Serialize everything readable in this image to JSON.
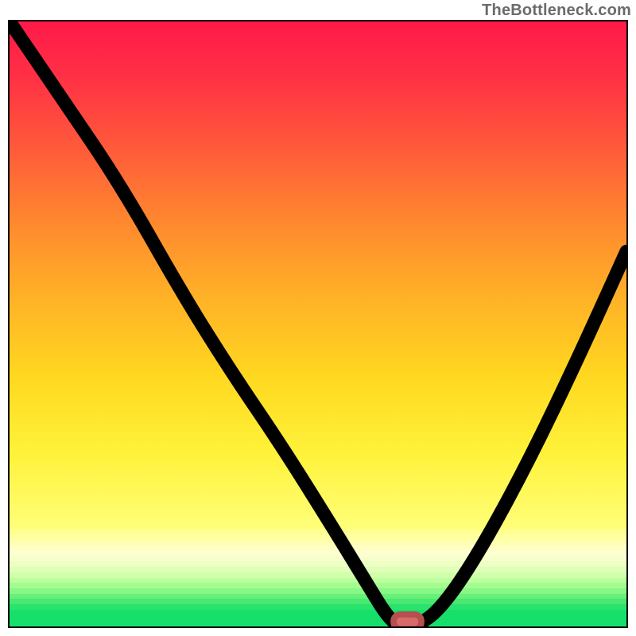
{
  "watermark": "TheBottleneck.com",
  "chart_data": {
    "type": "line",
    "title": "",
    "xlabel": "",
    "ylabel": "",
    "xlim": [
      0,
      100
    ],
    "ylim": [
      0,
      100
    ],
    "grid": false,
    "legend": false,
    "series": [
      {
        "name": "bottleneck-curve",
        "x": [
          0,
          8,
          18,
          28,
          36,
          44,
          52,
          58,
          61,
          63,
          66,
          70,
          76,
          84,
          92,
          100
        ],
        "y": [
          100,
          88,
          73,
          55,
          42,
          30,
          17,
          7,
          2,
          0,
          0,
          3,
          12,
          27,
          44,
          62
        ]
      }
    ],
    "marker": {
      "name": "optimal-point",
      "x": 64.5,
      "y": 0.8,
      "width": 4.5,
      "height": 2.4,
      "color": "#d96a6a"
    },
    "background_gradient": {
      "stops": [
        {
          "pos": 0,
          "color": "#ff1a49"
        },
        {
          "pos": 25,
          "color": "#ff5a3a"
        },
        {
          "pos": 55,
          "color": "#ffb326"
        },
        {
          "pos": 80,
          "color": "#fff23a"
        },
        {
          "pos": 92,
          "color": "#ffffb0"
        },
        {
          "pos": 97,
          "color": "#c7ff9e"
        },
        {
          "pos": 100,
          "color": "#16e06a"
        }
      ]
    },
    "step_bands": [
      "#ffff93",
      "#ffffa3",
      "#ffffb3",
      "#ffffc3",
      "#feffd0",
      "#f6ffca",
      "#edffc2",
      "#e0ffb8",
      "#d0ffac",
      "#bcff9e",
      "#a4fc90",
      "#88f786",
      "#68f07a",
      "#47e971",
      "#2ae36c"
    ]
  }
}
